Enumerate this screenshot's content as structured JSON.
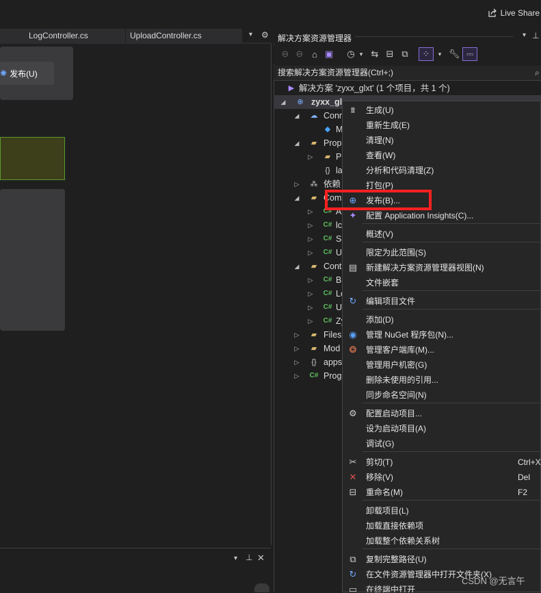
{
  "topbar": {
    "live_share": "Live Share"
  },
  "editor_tabs": [
    "LogController.cs",
    "UploadController.cs"
  ],
  "editor": {
    "publish_label": "发布(U)"
  },
  "solution_explorer": {
    "title": "解决方案资源管理器",
    "search_placeholder": "搜索解决方案资源管理器(Ctrl+;)",
    "tree": [
      {
        "label": "解决方案 'zyxx_glxt' (1 个项目，共 1 个)",
        "icon": "solution-icon"
      },
      {
        "label": "zyxx_gl",
        "icon": "project-icon"
      },
      {
        "label": "Conn",
        "icon": "connected-services-icon"
      },
      {
        "label": "M",
        "icon": "diamond-icon"
      },
      {
        "label": "Prop",
        "icon": "wrench-folder-icon"
      },
      {
        "label": "P",
        "icon": "folder-icon"
      },
      {
        "label": "la",
        "icon": "json-icon"
      },
      {
        "label": "依赖",
        "icon": "dependencies-icon"
      },
      {
        "label": "Com",
        "icon": "folder-icon"
      },
      {
        "label": "A",
        "icon": "csharp-icon"
      },
      {
        "label": "lc",
        "icon": "csharp-icon"
      },
      {
        "label": "Sc",
        "icon": "csharp-icon"
      },
      {
        "label": "U",
        "icon": "csharp-icon"
      },
      {
        "label": "Cont",
        "icon": "folder-icon"
      },
      {
        "label": "B",
        "icon": "csharp-icon"
      },
      {
        "label": "Lo",
        "icon": "csharp-icon"
      },
      {
        "label": "U",
        "icon": "csharp-icon"
      },
      {
        "label": "Zy",
        "icon": "csharp-icon"
      },
      {
        "label": "Files",
        "icon": "folder-icon"
      },
      {
        "label": "Mod",
        "icon": "folder-icon"
      },
      {
        "label": "apps",
        "icon": "json-icon"
      },
      {
        "label": "Prog",
        "icon": "csharp-icon"
      }
    ]
  },
  "context_menu": {
    "items": [
      {
        "label": "生成(U)",
        "icon": "build-icon"
      },
      {
        "label": "重新生成(E)"
      },
      {
        "label": "清理(N)"
      },
      {
        "label": "查看(W)"
      },
      {
        "label": "分析和代码清理(Z)"
      },
      {
        "label": "打包(P)"
      },
      {
        "label": "发布(B)...",
        "icon": "publish-globe-icon"
      },
      {
        "label": "配置 Application Insights(C)...",
        "icon": "insights-icon"
      },
      {
        "label": "概述(V)"
      },
      {
        "label": "限定为此范围(S)"
      },
      {
        "label": "新建解决方案资源管理器视图(N)",
        "icon": "new-view-icon"
      },
      {
        "label": "文件嵌套"
      },
      {
        "label": "编辑项目文件",
        "icon": "edit-refresh-icon"
      },
      {
        "label": "添加(D)"
      },
      {
        "label": "管理 NuGet 程序包(N)...",
        "icon": "nuget-icon"
      },
      {
        "label": "管理客户端库(M)...",
        "icon": "client-lib-icon"
      },
      {
        "label": "管理用户机密(G)"
      },
      {
        "label": "删除未使用的引用..."
      },
      {
        "label": "同步命名空间(N)"
      },
      {
        "label": "配置启动项目...",
        "icon": "gear-icon"
      },
      {
        "label": "设为启动项目(A)"
      },
      {
        "label": "调试(G)"
      },
      {
        "label": "剪切(T)",
        "icon": "scissors-icon",
        "shortcut": "Ctrl+X"
      },
      {
        "label": "移除(V)",
        "icon": "remove-x-icon",
        "shortcut": "Del"
      },
      {
        "label": "重命名(M)",
        "icon": "rename-icon",
        "shortcut": "F2"
      },
      {
        "label": "卸载项目(L)"
      },
      {
        "label": "加载直接依赖项"
      },
      {
        "label": "加载整个依赖关系树"
      },
      {
        "label": "复制完整路径(U)",
        "icon": "copy-icon"
      },
      {
        "label": "在文件资源管理器中打开文件夹(X)",
        "icon": "open-folder-icon"
      },
      {
        "label": "在终端中打开",
        "icon": "terminal-icon"
      }
    ]
  },
  "watermark": "CSDN @无言午",
  "colors": {
    "highlight_box": "#ff2020",
    "accent": "#8a6fd6"
  }
}
